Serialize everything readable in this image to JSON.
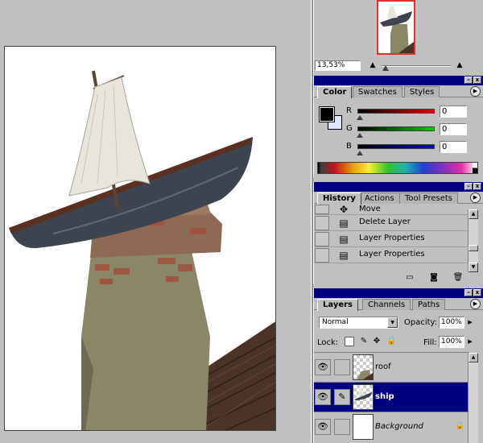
{
  "navigator": {
    "zoom": "13,53%",
    "zoom_out_icon": "zoom-out-mountain-small",
    "zoom_in_icon": "zoom-in-mountain-large"
  },
  "color": {
    "tabs": [
      "Color",
      "Swatches",
      "Styles"
    ],
    "channels": [
      {
        "label": "R",
        "value": "0",
        "gradient": "#e00000"
      },
      {
        "label": "G",
        "value": "0",
        "gradient": "#00d000"
      },
      {
        "label": "B",
        "value": "0",
        "gradient": "#0000e0"
      }
    ],
    "foreground": "#000000",
    "background": "#dbe7f4"
  },
  "history": {
    "tabs": [
      "History",
      "Actions",
      "Tool Presets"
    ],
    "items": [
      {
        "label": "Move",
        "icon": "move-icon"
      },
      {
        "label": "Delete Layer",
        "icon": "history-state-icon"
      },
      {
        "label": "Layer Properties",
        "icon": "history-state-icon"
      },
      {
        "label": "Layer Properties",
        "icon": "history-state-icon"
      }
    ]
  },
  "layers": {
    "tabs": [
      "Layers",
      "Channels",
      "Paths"
    ],
    "blend_mode": "Normal",
    "opacity_label": "Opacity:",
    "opacity": "100%",
    "lock_label": "Lock:",
    "fill_label": "Fill:",
    "fill": "100%",
    "items": [
      {
        "name": "roof",
        "selected": false,
        "visible": true
      },
      {
        "name": "ship",
        "selected": true,
        "visible": true
      },
      {
        "name": "Background",
        "selected": false,
        "visible": true,
        "locked": true
      }
    ]
  },
  "colors": {
    "titlebar": "#000080",
    "selection": "#000080",
    "panel_bg": "#c0c0c0"
  }
}
